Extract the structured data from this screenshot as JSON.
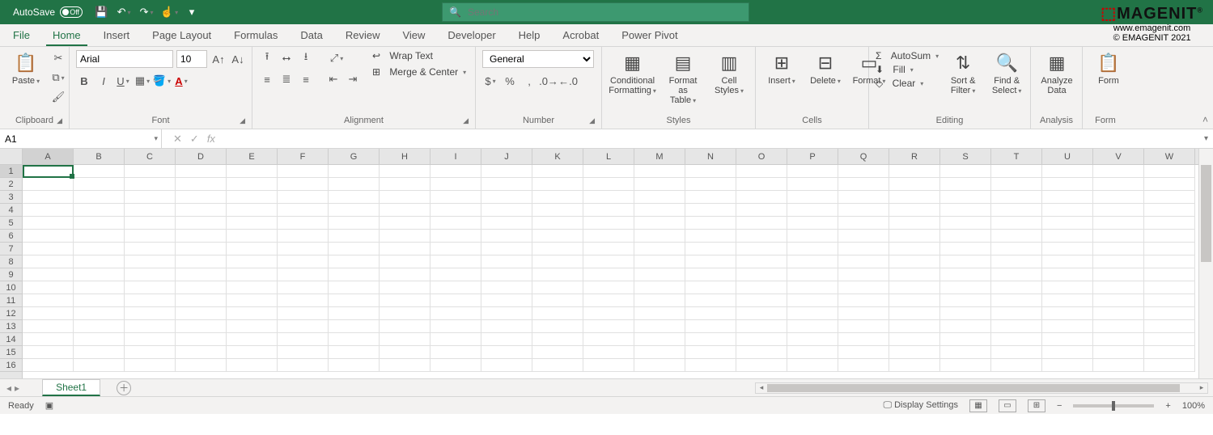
{
  "titlebar": {
    "autosave_label": "AutoSave",
    "autosave_state": "Off",
    "search_placeholder": "Search"
  },
  "brand": {
    "name": "MAGENIT",
    "url": "www.emagenit.com",
    "copyright": "© EMAGENIT  2021"
  },
  "tabs": [
    "File",
    "Home",
    "Insert",
    "Page Layout",
    "Formulas",
    "Data",
    "Review",
    "View",
    "Developer",
    "Help",
    "Acrobat",
    "Power Pivot"
  ],
  "active_tab": "Home",
  "ribbon": {
    "clipboard": {
      "paste": "Paste",
      "label": "Clipboard"
    },
    "font": {
      "name": "Arial",
      "size": "10",
      "label": "Font"
    },
    "alignment": {
      "wrap": "Wrap Text",
      "merge": "Merge & Center",
      "label": "Alignment"
    },
    "number": {
      "format": "General",
      "label": "Number"
    },
    "styles": {
      "cond": "Conditional Formatting",
      "table": "Format as Table",
      "cell": "Cell Styles",
      "label": "Styles"
    },
    "cells": {
      "insert": "Insert",
      "delete": "Delete",
      "format": "Format",
      "label": "Cells"
    },
    "editing": {
      "autosum": "AutoSum",
      "fill": "Fill",
      "clear": "Clear",
      "sort": "Sort & Filter",
      "find": "Find & Select",
      "label": "Editing"
    },
    "analysis": {
      "analyze": "Analyze Data",
      "label": "Analysis"
    },
    "form": {
      "form": "Form",
      "label": "Form"
    }
  },
  "formula_bar": {
    "cell_ref": "A1",
    "formula": ""
  },
  "columns": [
    "A",
    "B",
    "C",
    "D",
    "E",
    "F",
    "G",
    "H",
    "I",
    "J",
    "K",
    "L",
    "M",
    "N",
    "O",
    "P",
    "Q",
    "R",
    "S",
    "T",
    "U",
    "V",
    "W"
  ],
  "rows": [
    1,
    2,
    3,
    4,
    5,
    6,
    7,
    8,
    9,
    10,
    11,
    12,
    13,
    14,
    15,
    16
  ],
  "sheet": {
    "name": "Sheet1"
  },
  "status": {
    "ready": "Ready",
    "display": "Display Settings",
    "zoom": "100%"
  }
}
